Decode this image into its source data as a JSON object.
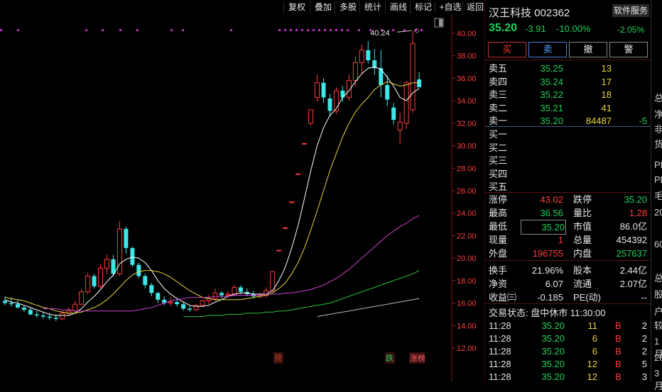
{
  "toolbar": {
    "buttons": [
      "复权",
      "叠加",
      "多股",
      "统计",
      "画线",
      "标记",
      "+自选",
      "返回"
    ]
  },
  "header": {
    "name": "汉王科技",
    "code": "002362",
    "service_label": "软件服务",
    "price": "35.20",
    "change": "-3.91",
    "change_pct": "-10.00%",
    "sector_pct": "-2.05%"
  },
  "trade_buttons": {
    "buy": "买",
    "sell": "卖",
    "cancel": "撤",
    "alert": "警"
  },
  "order_book": {
    "asks": [
      {
        "label": "卖五",
        "price": "35.25",
        "vol": "13",
        "extra": ""
      },
      {
        "label": "卖四",
        "price": "35.24",
        "vol": "17",
        "extra": ""
      },
      {
        "label": "卖三",
        "price": "35.22",
        "vol": "18",
        "extra": ""
      },
      {
        "label": "卖二",
        "price": "35.21",
        "vol": "41",
        "extra": ""
      },
      {
        "label": "卖一",
        "price": "35.20",
        "vol": "84487",
        "extra": "-5"
      }
    ],
    "bids": [
      {
        "label": "买一"
      },
      {
        "label": "买二"
      },
      {
        "label": "买三"
      },
      {
        "label": "买四"
      },
      {
        "label": "买五"
      }
    ]
  },
  "stats": {
    "limit_up_label": "涨停",
    "limit_up": "43.02",
    "limit_down_label": "跌停",
    "limit_down": "35.20",
    "high_label": "最高",
    "high": "36.56",
    "vol_ratio_label": "量比",
    "vol_ratio": "1.28",
    "low_label": "最低",
    "low": "35.20",
    "mktcap_label": "市值",
    "mktcap": "86.0亿",
    "cur_vol_label": "现量",
    "cur_vol": "1",
    "total_vol_label": "总量",
    "total_vol": "454392",
    "outer_label": "外盘",
    "outer": "196755",
    "inner_label": "内盘",
    "inner": "257637",
    "turnover_label": "换手",
    "turnover": "21.96%",
    "equity_label": "股本",
    "equity": "2.44亿",
    "net_asset_label": "净资",
    "net_asset": "6.07",
    "float_label": "流通",
    "float": "2.07亿",
    "eps_label": "收益㈢",
    "eps": "-0.185",
    "pe_label": "PE(动)",
    "pe": "--"
  },
  "trade_status": "交易状态: 盘中休市 11:30:00",
  "ticks": [
    {
      "time": "11:28",
      "price": "35.20",
      "vol": "11",
      "side": "B",
      "count": "2"
    },
    {
      "time": "11:28",
      "price": "35.20",
      "vol": "6",
      "side": "B",
      "count": "2"
    },
    {
      "time": "11:28",
      "price": "35.20",
      "vol": "6",
      "side": "B",
      "count": "2"
    },
    {
      "time": "11:28",
      "price": "35.20",
      "vol": "12",
      "side": "B",
      "count": "5"
    },
    {
      "time": "11:28",
      "price": "35.20",
      "vol": "12",
      "side": "B",
      "count": "3"
    }
  ],
  "edge_chars": [
    "总",
    "净",
    "非",
    "货",
    "PE",
    "PE",
    "毛",
    "20",
    "60",
    "总",
    "股",
    "户",
    "较",
    "1月",
    "20",
    "3月"
  ],
  "colors": {
    "up": "#ff3b3b",
    "down": "#3ee6e6",
    "ma5": "#ffffff",
    "ma10": "#e8d640",
    "ma20": "#d040d0",
    "ma60": "#30c040",
    "ma120": "#bbbbbb",
    "marker": "#c030c0"
  },
  "chart_data": {
    "type": "candlestick",
    "ylim": [
      11.0,
      40.8
    ],
    "y_ticks": [
      "40.00",
      "38.00",
      "36.00",
      "34.00",
      "32.00",
      "30.00",
      "28.00",
      "26.00",
      "24.00",
      "22.00",
      "20.00",
      "18.00",
      "16.00",
      "14.00",
      "12.00"
    ],
    "y_tick_values": [
      40,
      38,
      36,
      34,
      32,
      30,
      28,
      26,
      24,
      22,
      20,
      18,
      16,
      14,
      12
    ],
    "high_annotation": "40.24",
    "event_labels": [
      "预",
      "跌",
      "涨榜"
    ],
    "candles": [
      {
        "o": 16.2,
        "h": 16.6,
        "l": 15.8,
        "c": 16.0
      },
      {
        "o": 16.0,
        "h": 16.5,
        "l": 15.7,
        "c": 15.9
      },
      {
        "o": 15.9,
        "h": 16.3,
        "l": 15.5,
        "c": 15.6
      },
      {
        "o": 15.6,
        "h": 15.8,
        "l": 15.2,
        "c": 15.4
      },
      {
        "o": 15.4,
        "h": 15.6,
        "l": 14.9,
        "c": 15.0
      },
      {
        "o": 15.0,
        "h": 15.3,
        "l": 14.7,
        "c": 14.9
      },
      {
        "o": 14.9,
        "h": 15.2,
        "l": 14.6,
        "c": 14.8
      },
      {
        "o": 14.8,
        "h": 15.1,
        "l": 14.5,
        "c": 14.7
      },
      {
        "o": 14.7,
        "h": 15.0,
        "l": 14.4,
        "c": 14.6
      },
      {
        "o": 14.6,
        "h": 15.3,
        "l": 14.5,
        "c": 15.1
      },
      {
        "o": 15.1,
        "h": 15.6,
        "l": 14.9,
        "c": 15.3
      },
      {
        "o": 15.3,
        "h": 16.2,
        "l": 15.1,
        "c": 15.9
      },
      {
        "o": 15.9,
        "h": 17.3,
        "l": 15.8,
        "c": 17.0
      },
      {
        "o": 17.0,
        "h": 18.7,
        "l": 16.8,
        "c": 18.4
      },
      {
        "o": 18.4,
        "h": 18.6,
        "l": 17.3,
        "c": 17.5
      },
      {
        "o": 17.5,
        "h": 19.4,
        "l": 17.3,
        "c": 19.1
      },
      {
        "o": 19.1,
        "h": 20.3,
        "l": 18.6,
        "c": 19.9
      },
      {
        "o": 19.9,
        "h": 20.3,
        "l": 18.4,
        "c": 18.6
      },
      {
        "o": 18.6,
        "h": 23.3,
        "l": 18.4,
        "c": 22.6
      },
      {
        "o": 22.6,
        "h": 22.8,
        "l": 20.4,
        "c": 20.9
      },
      {
        "o": 20.9,
        "h": 21.0,
        "l": 19.2,
        "c": 19.4
      },
      {
        "o": 19.4,
        "h": 19.6,
        "l": 18.2,
        "c": 18.4
      },
      {
        "o": 18.4,
        "h": 18.6,
        "l": 17.3,
        "c": 17.6
      },
      {
        "o": 17.6,
        "h": 17.8,
        "l": 16.6,
        "c": 16.9
      },
      {
        "o": 16.9,
        "h": 17.0,
        "l": 16.0,
        "c": 16.3
      },
      {
        "o": 16.3,
        "h": 16.6,
        "l": 15.8,
        "c": 16.0
      },
      {
        "o": 16.0,
        "h": 16.5,
        "l": 15.7,
        "c": 16.1
      },
      {
        "o": 16.1,
        "h": 16.3,
        "l": 15.7,
        "c": 15.9
      },
      {
        "o": 15.9,
        "h": 16.1,
        "l": 15.3,
        "c": 15.5
      },
      {
        "o": 15.5,
        "h": 15.8,
        "l": 15.2,
        "c": 15.4
      },
      {
        "o": 15.4,
        "h": 15.9,
        "l": 15.3,
        "c": 15.8
      },
      {
        "o": 15.8,
        "h": 16.3,
        "l": 15.7,
        "c": 16.2
      },
      {
        "o": 16.2,
        "h": 16.7,
        "l": 15.9,
        "c": 16.4
      },
      {
        "o": 16.4,
        "h": 17.3,
        "l": 16.2,
        "c": 16.9
      },
      {
        "o": 16.9,
        "h": 17.1,
        "l": 16.4,
        "c": 16.7
      },
      {
        "o": 16.7,
        "h": 17.1,
        "l": 16.5,
        "c": 16.8
      },
      {
        "o": 16.8,
        "h": 17.6,
        "l": 16.6,
        "c": 17.4
      },
      {
        "o": 17.4,
        "h": 17.6,
        "l": 16.8,
        "c": 17.0
      },
      {
        "o": 17.0,
        "h": 17.3,
        "l": 16.6,
        "c": 16.8
      },
      {
        "o": 16.8,
        "h": 17.1,
        "l": 16.4,
        "c": 16.6
      },
      {
        "o": 16.6,
        "h": 16.9,
        "l": 16.4,
        "c": 16.7
      },
      {
        "o": 16.7,
        "h": 17.4,
        "l": 16.5,
        "c": 17.1
      },
      {
        "o": 17.1,
        "h": 18.8,
        "l": 17.1,
        "c": 18.8
      },
      {
        "o": 20.7,
        "h": 20.7,
        "l": 20.7,
        "c": 20.7
      },
      {
        "o": 22.7,
        "h": 22.7,
        "l": 22.7,
        "c": 22.7
      },
      {
        "o": 25.0,
        "h": 25.0,
        "l": 25.0,
        "c": 25.0
      },
      {
        "o": 27.5,
        "h": 27.5,
        "l": 27.5,
        "c": 27.5
      },
      {
        "o": 30.2,
        "h": 30.2,
        "l": 30.2,
        "c": 30.2
      },
      {
        "o": 32.0,
        "h": 33.2,
        "l": 31.8,
        "c": 33.2
      },
      {
        "o": 34.3,
        "h": 36.3,
        "l": 33.9,
        "c": 35.6
      },
      {
        "o": 35.6,
        "h": 36.0,
        "l": 33.8,
        "c": 34.3
      },
      {
        "o": 34.2,
        "h": 34.6,
        "l": 32.6,
        "c": 33.1
      },
      {
        "o": 33.1,
        "h": 35.2,
        "l": 32.8,
        "c": 34.9
      },
      {
        "o": 34.9,
        "h": 35.3,
        "l": 33.9,
        "c": 34.3
      },
      {
        "o": 34.3,
        "h": 36.3,
        "l": 34.0,
        "c": 35.8
      },
      {
        "o": 35.8,
        "h": 37.9,
        "l": 35.3,
        "c": 37.4
      },
      {
        "o": 37.4,
        "h": 39.0,
        "l": 36.4,
        "c": 38.5
      },
      {
        "o": 38.5,
        "h": 39.3,
        "l": 37.3,
        "c": 37.6
      },
      {
        "o": 37.6,
        "h": 38.6,
        "l": 36.3,
        "c": 36.9
      },
      {
        "o": 36.9,
        "h": 38.5,
        "l": 34.3,
        "c": 35.4
      },
      {
        "o": 35.4,
        "h": 36.3,
        "l": 33.5,
        "c": 34.1
      },
      {
        "o": 33.4,
        "h": 33.8,
        "l": 31.9,
        "c": 32.3
      },
      {
        "o": 31.4,
        "h": 32.9,
        "l": 30.1,
        "c": 32.1
      },
      {
        "o": 32.0,
        "h": 35.8,
        "l": 31.5,
        "c": 35.6
      },
      {
        "o": 33.2,
        "h": 40.24,
        "l": 32.9,
        "c": 39.1
      },
      {
        "o": 35.9,
        "h": 36.56,
        "l": 35.2,
        "c": 35.2
      }
    ],
    "ma5": [
      16.3,
      16.1,
      16.0,
      15.8,
      15.6,
      15.4,
      15.2,
      15.0,
      14.9,
      14.9,
      14.9,
      15.1,
      15.5,
      16.1,
      16.6,
      17.2,
      17.9,
      18.5,
      19.5,
      19.9,
      20.1,
      20.0,
      19.6,
      18.9,
      18.0,
      17.3,
      16.8,
      16.4,
      16.1,
      15.8,
      15.7,
      15.7,
      15.8,
      16.1,
      16.3,
      16.6,
      16.8,
      16.9,
      16.9,
      16.8,
      16.8,
      16.8,
      17.1,
      18.0,
      19.2,
      20.9,
      22.9,
      25.3,
      27.8,
      30.0,
      31.6,
      32.7,
      33.3,
      34.3,
      34.9,
      35.7,
      36.4,
      36.9,
      37.0,
      36.8,
      36.1,
      35.3,
      34.3,
      34.0,
      34.7,
      35.1
    ],
    "ma10": [
      16.5,
      16.4,
      16.3,
      16.2,
      16.0,
      15.8,
      15.6,
      15.5,
      15.3,
      15.2,
      15.1,
      15.1,
      15.2,
      15.4,
      15.6,
      15.9,
      16.3,
      16.8,
      17.4,
      18.0,
      18.5,
      18.8,
      18.9,
      18.9,
      18.8,
      18.6,
      18.3,
      17.9,
      17.5,
      17.1,
      16.8,
      16.5,
      16.4,
      16.3,
      16.3,
      16.3,
      16.3,
      16.3,
      16.4,
      16.5,
      16.6,
      16.7,
      16.9,
      17.3,
      17.8,
      18.6,
      19.6,
      20.9,
      22.5,
      24.2,
      26.0,
      27.8,
      29.3,
      30.8,
      32.0,
      33.0,
      33.7,
      34.3,
      35.0,
      35.4,
      35.7,
      35.5,
      35.3,
      35.4,
      35.6,
      35.6
    ],
    "ma20": [
      15.5,
      15.5,
      15.5,
      15.4,
      15.4,
      15.3,
      15.3,
      15.3,
      15.3,
      15.3,
      15.3,
      15.3,
      15.3,
      15.3,
      15.3,
      15.4,
      15.5,
      15.6,
      15.8,
      16.0,
      16.2,
      16.3,
      16.4,
      16.5,
      16.5,
      16.5,
      16.5,
      16.6,
      16.6,
      16.6,
      16.7,
      16.7,
      16.7,
      16.7,
      16.7,
      16.8,
      16.8,
      16.8,
      16.9,
      16.9,
      17.0,
      17.1,
      17.2,
      17.4,
      17.6,
      17.9,
      18.2,
      18.6,
      19.0,
      19.5,
      20.0,
      20.5,
      21.0,
      21.5,
      22.0,
      22.4,
      22.8,
      23.1,
      23.5,
      23.8
    ],
    "ma60": [
      14.8,
      14.8,
      14.8,
      14.8,
      14.9,
      14.9,
      14.9,
      15.0,
      15.0,
      15.0,
      15.1,
      15.1,
      15.1,
      15.2,
      15.2,
      15.3,
      15.3,
      15.4,
      15.5,
      15.6,
      15.7,
      15.8,
      15.9,
      16.0,
      16.2,
      16.4,
      16.6,
      16.8,
      17.0,
      17.2,
      17.4,
      17.6,
      17.8,
      18.0,
      18.2,
      18.4,
      18.6,
      18.9
    ],
    "ma120": [
      14.8,
      14.9,
      15.0,
      15.1,
      15.2,
      15.3,
      15.4,
      15.5,
      15.6,
      15.7,
      15.8,
      15.9,
      16.0,
      16.1,
      16.2,
      16.3,
      16.4
    ]
  }
}
